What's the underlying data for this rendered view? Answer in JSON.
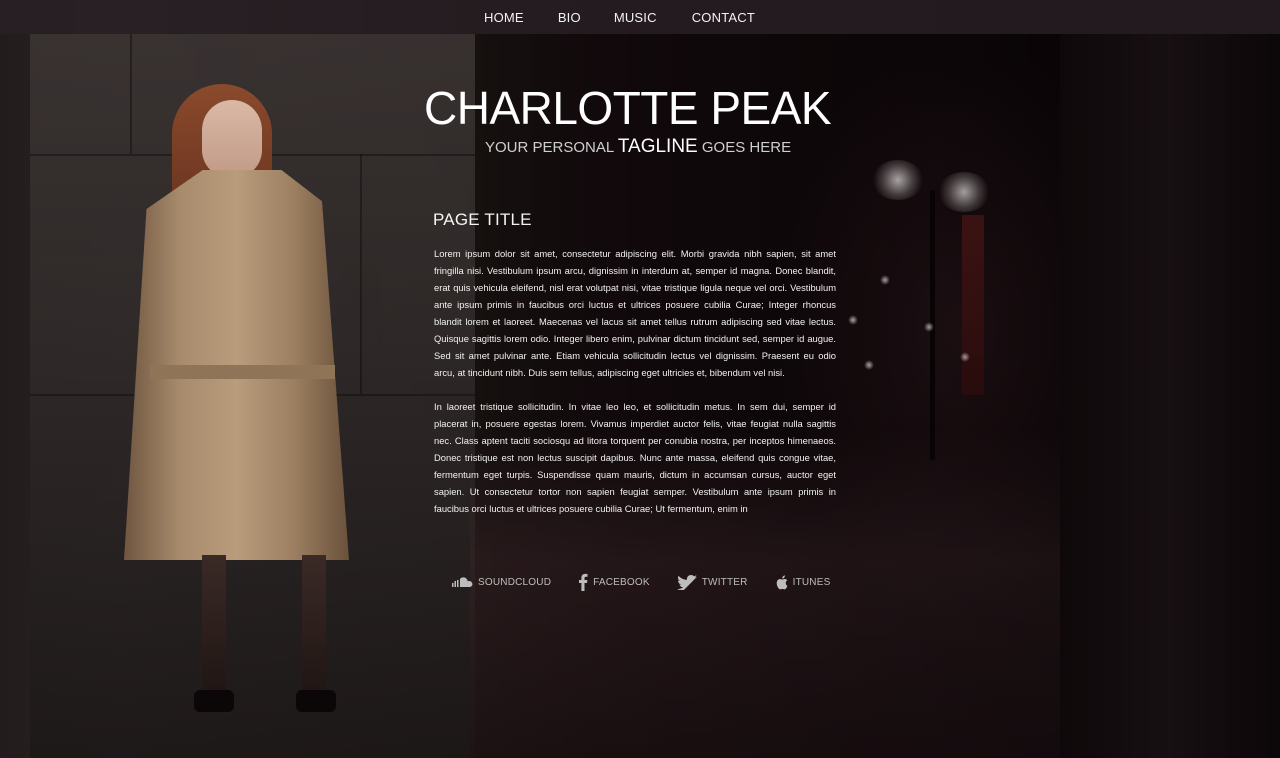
{
  "nav": {
    "items": [
      {
        "label": "HOME"
      },
      {
        "label": "BIO"
      },
      {
        "label": "MUSIC"
      },
      {
        "label": "CONTACT"
      }
    ]
  },
  "header": {
    "site_title": "CHARLOTTE PEAK",
    "tagline_prefix": "YOUR PERSONAL",
    "tagline_strong": "TAGLINE",
    "tagline_suffix": "GOES HERE"
  },
  "main": {
    "page_title": "PAGE TITLE",
    "paragraphs": [
      "Lorem ipsum dolor sit amet, consectetur adipiscing elit. Morbi gravida nibh sapien, sit amet fringilla nisi. Vestibulum ipsum arcu, dignissim in interdum at, semper id magna. Donec blandit, erat quis vehicula eleifend, nisl erat volutpat nisi, vitae tristique ligula neque vel orci. Vestibulum ante ipsum primis in faucibus orci luctus et ultrices posuere cubilia Curae; Integer rhoncus blandit lorem et laoreet. Maecenas vel lacus sit amet tellus rutrum adipiscing sed vitae lectus. Quisque sagittis lorem odio. Integer libero enim, pulvinar dictum tincidunt sed, semper id augue. Sed sit amet pulvinar ante. Etiam vehicula sollicitudin lectus vel dignissim. Praesent eu odio arcu, at tincidunt nibh. Duis sem tellus, adipiscing eget ultricies et, bibendum vel nisi.",
      "In laoreet tristique sollicitudin. In vitae leo leo, et sollicitudin metus. In sem dui, semper id placerat in, posuere egestas lorem. Vivamus imperdiet auctor felis, vitae feugiat nulla sagittis nec. Class aptent taciti sociosqu ad litora torquent per conubia nostra, per inceptos himenaeos. Donec tristique est non lectus suscipit dapibus. Nunc ante massa, eleifend quis congue vitae, fermentum eget turpis. Suspendisse quam mauris, dictum in accumsan cursus, auctor eget sapien. Ut consectetur tortor non sapien feugiat semper. Vestibulum ante ipsum primis in faucibus orci luctus et ultrices posuere cubilia Curae; Ut fermentum, enim in"
    ]
  },
  "social": {
    "links": [
      {
        "label": "SOUNDCLOUD",
        "icon": "soundcloud-icon"
      },
      {
        "label": "FACEBOOK",
        "icon": "facebook-icon"
      },
      {
        "label": "TWITTER",
        "icon": "twitter-icon"
      },
      {
        "label": "ITUNES",
        "icon": "apple-icon"
      }
    ]
  },
  "colors": {
    "nav_bg": "#282024",
    "text": "#ffffff",
    "muted": "#bdbdbd"
  }
}
